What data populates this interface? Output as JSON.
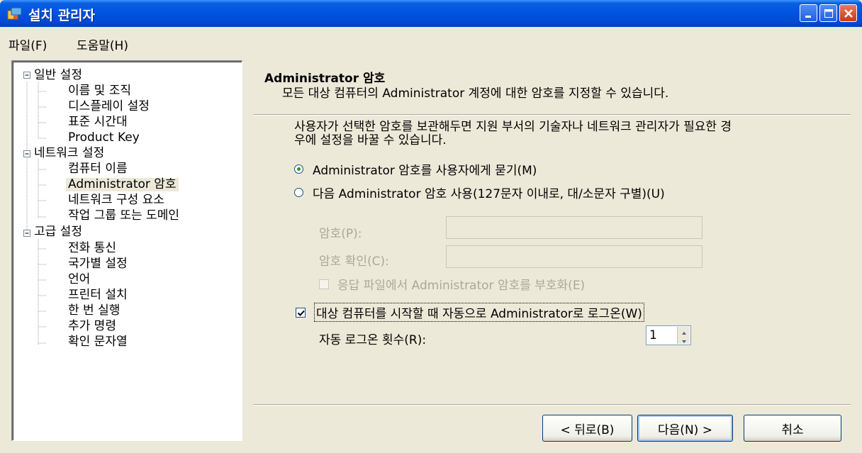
{
  "window": {
    "title": "설치 관리자",
    "icon": "setup-manager-icon"
  },
  "menu": {
    "file": "파일(F)",
    "help": "도움말(H)"
  },
  "tree": {
    "groups": [
      {
        "label": "일반 설정",
        "items": [
          "이름 및 조직",
          "디스플레이 설정",
          "표준 시간대",
          "Product Key"
        ]
      },
      {
        "label": "네트워크 설정",
        "items": [
          "컴퓨터 이름",
          "Administrator 암호",
          "네트워크 구성 요소",
          "작업 그룹 또는 도메인"
        ]
      },
      {
        "label": "고급 설정",
        "items": [
          "전화 통신",
          "국가별 설정",
          "언어",
          "프린터 설치",
          "한 번 실행",
          "추가 명령",
          "확인 문자열"
        ]
      }
    ],
    "selected": "Administrator 암호"
  },
  "header": {
    "title": "Administrator 암호",
    "description": "모든 대상 컴퓨터의 Administrator 계정에 대한 암호를 지정할 수 있습니다."
  },
  "content": {
    "intro_line1": "사용자가 선택한 암호를 보관해두면 지원 부서의 기술자나 네트워크 관리자가 필요한 경",
    "intro_line2": "우에 설정을 바꿀 수 있습니다.",
    "radio_ask": "Administrator 암호를 사용자에게 묻기(M)",
    "radio_use": "다음 Administrator 암호 사용(127문자 이내로, 대/소문자 구별)(U)",
    "radio_selected": "ask",
    "password_label": "암호(P):",
    "password_value": "",
    "confirm_label": "암호 확인(C):",
    "confirm_value": "",
    "encrypt_label": "응답 파일에서 Administrator 암호를 부호화(E)",
    "encrypt_checked": false,
    "autologon_label": "대상 컴퓨터를 시작할 때 자동으로 Administrator로 로그온(W)",
    "autologon_checked": true,
    "autologon_count_label": "자동 로그온 횟수(R):",
    "autologon_count": "1"
  },
  "buttons": {
    "back": "< 뒤로(B)",
    "next": "다음(N) >",
    "cancel": "취소"
  },
  "colors": {
    "titlebar": "#0054e3",
    "dialog_bg": "#ece9d8",
    "disabled_text": "#aca899",
    "radio_dot": "#21a121"
  }
}
